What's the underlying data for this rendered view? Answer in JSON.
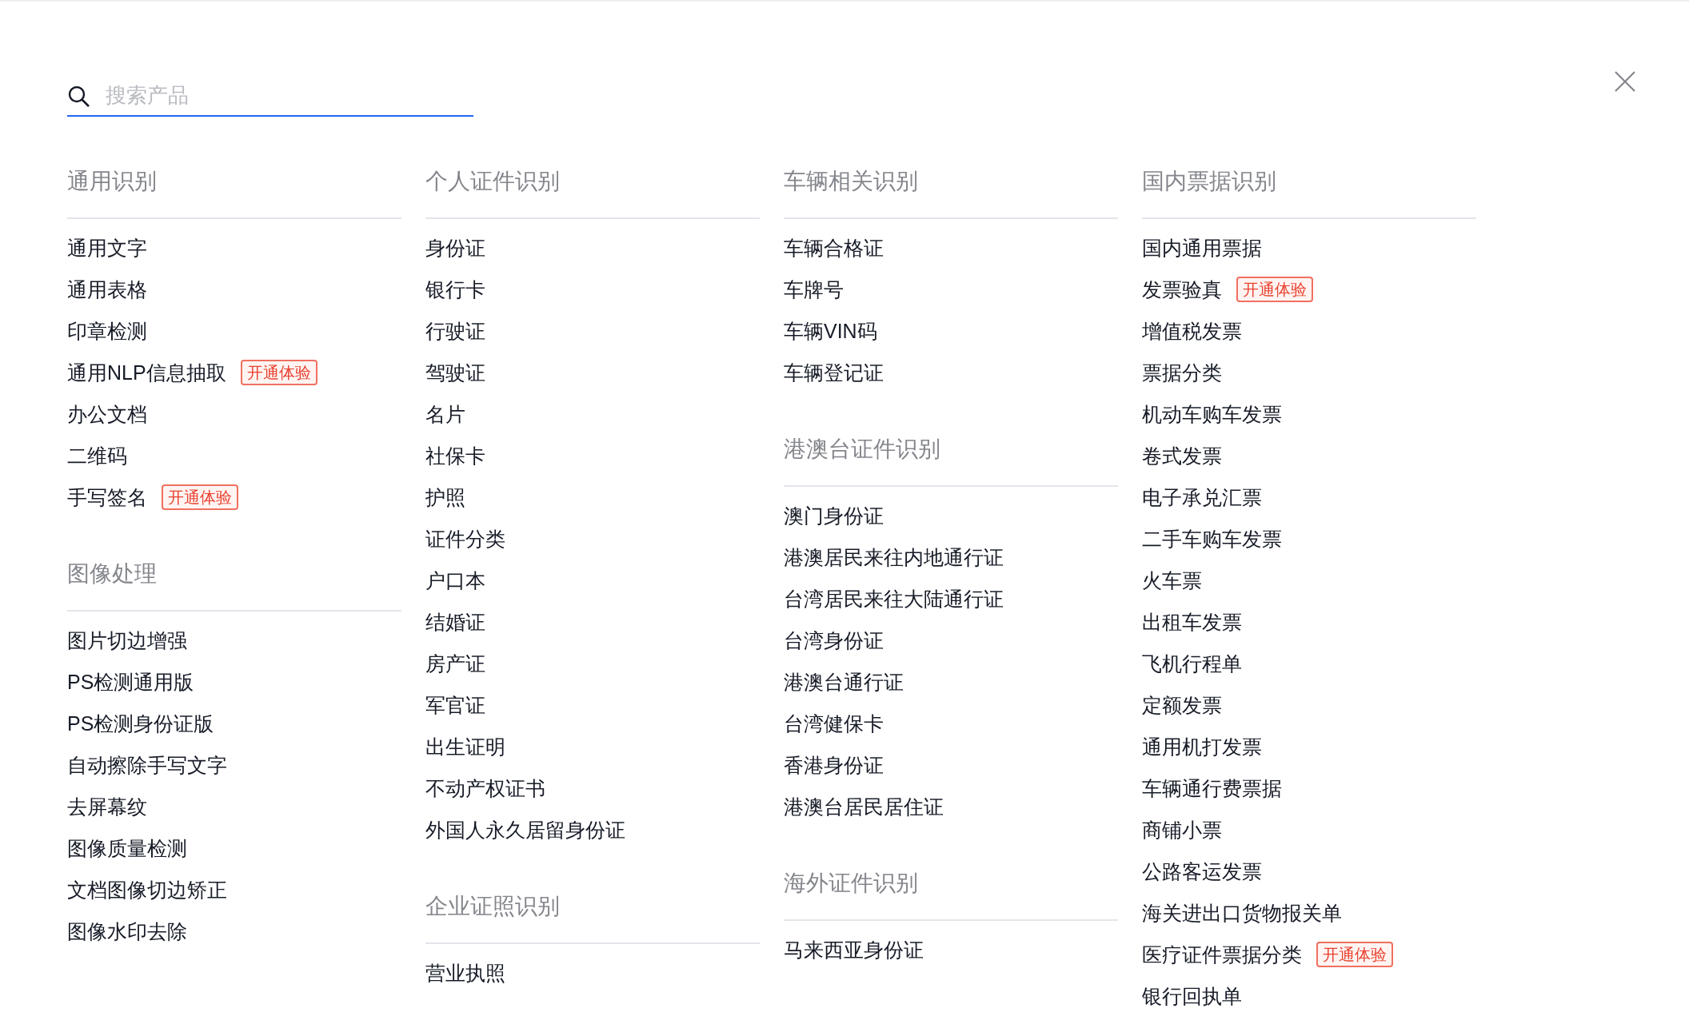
{
  "search": {
    "placeholder": "搜索产品"
  },
  "columns": [
    {
      "sections": [
        {
          "title": "通用识别",
          "items": [
            {
              "label": "通用文字"
            },
            {
              "label": "通用表格"
            },
            {
              "label": "印章检测"
            },
            {
              "label": "通用NLP信息抽取",
              "badge": "开通体验"
            },
            {
              "label": "办公文档"
            },
            {
              "label": "二维码"
            },
            {
              "label": "手写签名",
              "badge": "开通体验"
            }
          ]
        },
        {
          "title": "图像处理",
          "items": [
            {
              "label": "图片切边增强"
            },
            {
              "label": "PS检测通用版"
            },
            {
              "label": "PS检测身份证版"
            },
            {
              "label": "自动擦除手写文字"
            },
            {
              "label": "去屏幕纹"
            },
            {
              "label": "图像质量检测"
            },
            {
              "label": "文档图像切边矫正"
            },
            {
              "label": "图像水印去除"
            }
          ]
        }
      ]
    },
    {
      "sections": [
        {
          "title": "个人证件识别",
          "items": [
            {
              "label": "身份证"
            },
            {
              "label": "银行卡"
            },
            {
              "label": "行驶证"
            },
            {
              "label": "驾驶证"
            },
            {
              "label": "名片"
            },
            {
              "label": "社保卡"
            },
            {
              "label": "护照"
            },
            {
              "label": "证件分类"
            },
            {
              "label": "户口本"
            },
            {
              "label": "结婚证"
            },
            {
              "label": "房产证"
            },
            {
              "label": "军官证"
            },
            {
              "label": "出生证明"
            },
            {
              "label": "不动产权证书"
            },
            {
              "label": "外国人永久居留身份证"
            }
          ]
        },
        {
          "title": "企业证照识别",
          "items": [
            {
              "label": "营业执照"
            }
          ]
        }
      ]
    },
    {
      "sections": [
        {
          "title": "车辆相关识别",
          "items": [
            {
              "label": "车辆合格证"
            },
            {
              "label": "车牌号"
            },
            {
              "label": "车辆VIN码"
            },
            {
              "label": "车辆登记证"
            }
          ]
        },
        {
          "title": "港澳台证件识别",
          "items": [
            {
              "label": "澳门身份证"
            },
            {
              "label": "港澳居民来往内地通行证"
            },
            {
              "label": "台湾居民来往大陆通行证"
            },
            {
              "label": "台湾身份证"
            },
            {
              "label": "港澳台通行证"
            },
            {
              "label": "台湾健保卡"
            },
            {
              "label": "香港身份证"
            },
            {
              "label": "港澳台居民居住证"
            }
          ]
        },
        {
          "title": "海外证件识别",
          "items": [
            {
              "label": "马来西亚身份证"
            }
          ]
        }
      ]
    },
    {
      "sections": [
        {
          "title": "国内票据识别",
          "items": [
            {
              "label": "国内通用票据"
            },
            {
              "label": "发票验真",
              "badge": "开通体验"
            },
            {
              "label": "增值税发票"
            },
            {
              "label": "票据分类"
            },
            {
              "label": "机动车购车发票"
            },
            {
              "label": "卷式发票"
            },
            {
              "label": "电子承兑汇票"
            },
            {
              "label": "二手车购车发票"
            },
            {
              "label": "火车票"
            },
            {
              "label": "出租车发票"
            },
            {
              "label": "飞机行程单"
            },
            {
              "label": "定额发票"
            },
            {
              "label": "通用机打发票"
            },
            {
              "label": "车辆通行费票据"
            },
            {
              "label": "商铺小票"
            },
            {
              "label": "公路客运发票"
            },
            {
              "label": "海关进出口货物报关单"
            },
            {
              "label": "医疗证件票据分类",
              "badge": "开通体验"
            },
            {
              "label": "银行回执单"
            }
          ]
        }
      ]
    }
  ]
}
